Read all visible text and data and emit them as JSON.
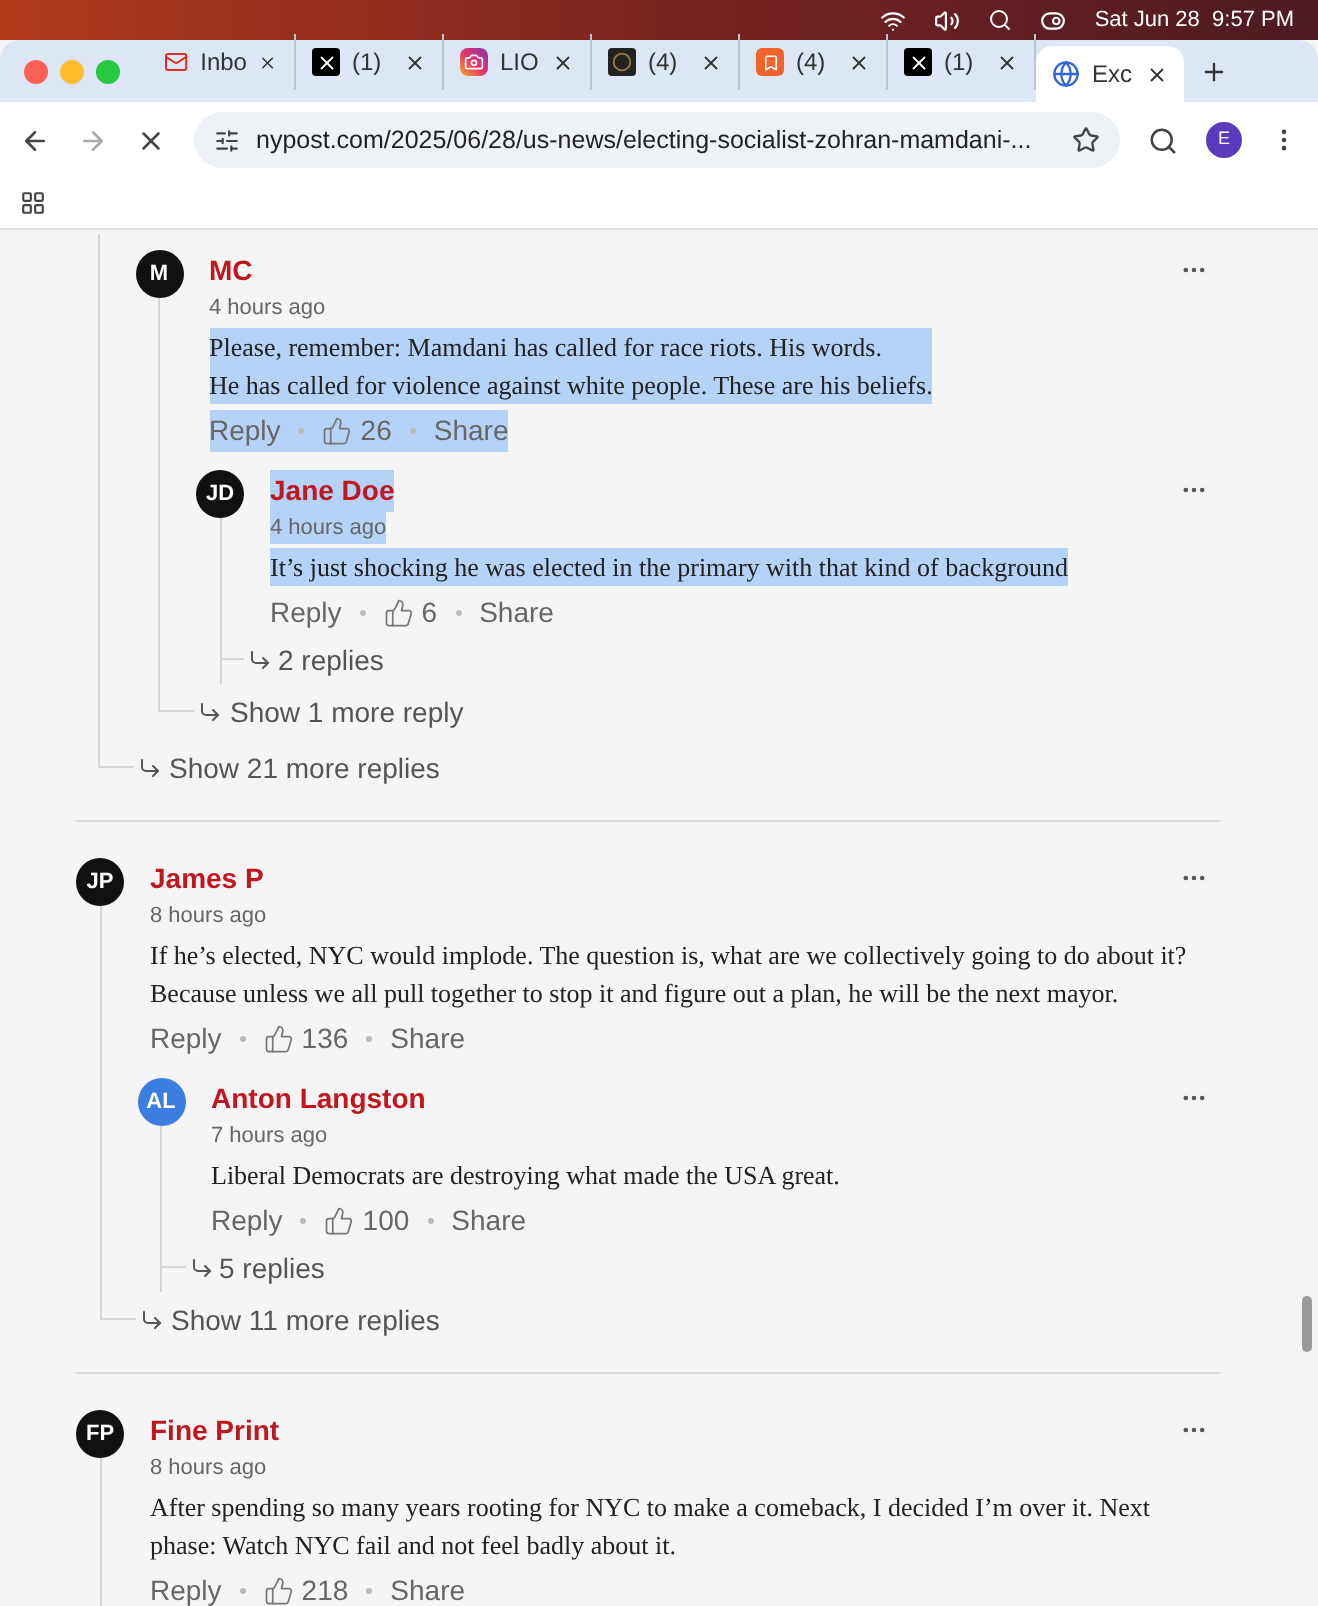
{
  "menu_bar": {
    "clock": "Sat Jun 28  9:57 PM"
  },
  "tabs": [
    {
      "label": "Inbo",
      "kind": "mail",
      "selected": false
    },
    {
      "label": "(1)",
      "kind": "x",
      "selected": false
    },
    {
      "label": "LIO",
      "kind": "camera",
      "selected": false
    },
    {
      "label": "(4)",
      "kind": "coin",
      "selected": false
    },
    {
      "label": "(4)",
      "kind": "bookmark",
      "selected": false
    },
    {
      "label": "(1)",
      "kind": "x",
      "selected": false
    },
    {
      "label": "Exc",
      "kind": "globe",
      "selected": true
    }
  ],
  "address_bar": {
    "url": "nypost.com/2025/06/28/us-news/electing-socialist-zohran-mamdani-..."
  },
  "profile": {
    "initial": "E"
  },
  "threads": [
    {
      "kind": "continued",
      "replies": [
        {
          "initials": "M",
          "color": "#111111",
          "name": "MC",
          "time": "4 hours ago",
          "body": "Please, remember: Mamdani has called for race riots. His words.\nHe has called for violence against white people. These are his beliefs.",
          "likes": "26",
          "reply": "Reply",
          "share": "Share",
          "highlight": {
            "name": false,
            "time": false,
            "body": true,
            "actions": true
          },
          "replies": [
            {
              "initials": "JD",
              "color": "#111111",
              "name": "Jane Doe",
              "time": "4 hours ago",
              "body": "It’s just shocking he was elected in the primary with that kind of background",
              "likes": "6",
              "reply": "Reply",
              "share": "Share",
              "highlight": {
                "name": true,
                "time": true,
                "body": true,
                "actions": false
              },
              "replies_link": "2 replies"
            }
          ],
          "more": "Show 1 more reply"
        }
      ],
      "more": "Show 21 more replies"
    },
    {
      "kind": "comment",
      "comment": {
        "initials": "JP",
        "color": "#111111",
        "name": "James P",
        "time": "8 hours ago",
        "body": "If he’s elected, NYC would implode. The question is, what are we collectively going to do about it? Because unless we all pull together to stop it and figure out a plan, he will be the next mayor.",
        "likes": "136",
        "reply": "Reply",
        "share": "Share",
        "highlight": {
          "name": false,
          "time": false,
          "body": false,
          "actions": false
        },
        "replies": [
          {
            "initials": "AL",
            "color": "#3b7de0",
            "name": "Anton Langston",
            "time": "7 hours ago",
            "body": "Liberal Democrats are destroying what made the USA great.",
            "likes": "100",
            "reply": "Reply",
            "share": "Share",
            "highlight": {
              "name": false,
              "time": false,
              "body": false,
              "actions": false
            },
            "replies_link": "5 replies"
          }
        ],
        "more": "Show 11 more replies"
      }
    },
    {
      "kind": "comment",
      "comment": {
        "initials": "FP",
        "color": "#111111",
        "name": "Fine Print",
        "time": "8 hours ago",
        "body": "After spending so many years rooting for NYC to make a comeback, I decided I’m over it. Next phase: Watch NYC fail and not feel badly about it.",
        "likes": "218",
        "reply": "Reply",
        "share": "Share",
        "highlight": {
          "name": false,
          "time": false,
          "body": false,
          "actions": false
        }
      }
    }
  ]
}
